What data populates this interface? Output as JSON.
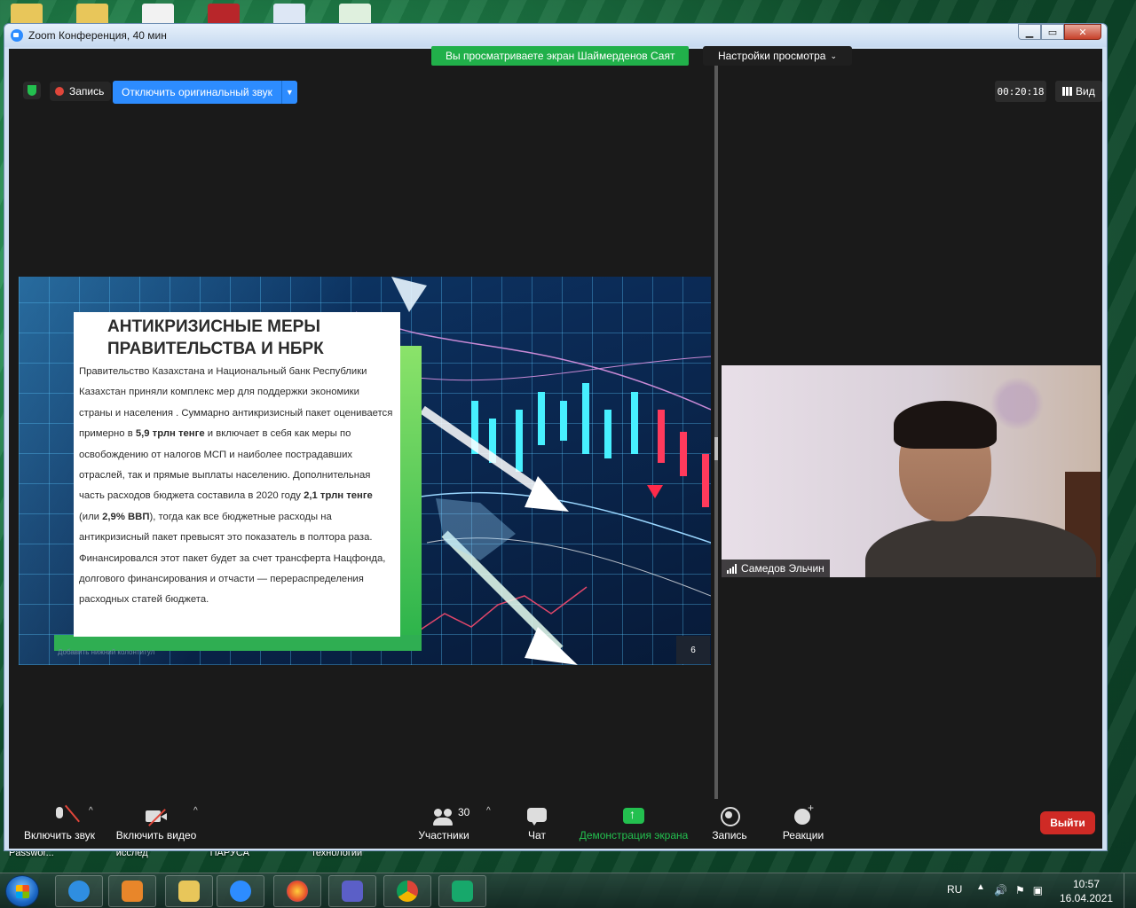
{
  "window": {
    "title": "Zoom Конференция, 40 мин",
    "share_banner": "Вы просматриваете экран Шаймерденов Саят",
    "view_settings": "Настройки просмотра"
  },
  "top_controls": {
    "record_label": "Запись",
    "audio_button": "Отключить оригинальный звук",
    "timer": "00:20:18",
    "view_label": "Вид"
  },
  "slide": {
    "title_line1": "АНТИКРИЗИСНЫЕ МЕРЫ",
    "title_line2": "ПРАВИТЕЛЬСТВА И НБРК",
    "body_part1": "Правительство Казахстана и Национальный банк Республики Казахстан  приняли комплекс мер для поддержки экономики страны и населения . Суммарно антикризисный пакет оценивается примерно в ",
    "bold1": "5,9 трлн тенге",
    "body_part2": " и включает в себя как меры по освобождению от налогов МСП и наиболее пострадавших отраслей, так и прямые выплаты населению. Дополнительная часть расходов бюджета составила в 2020 году ",
    "bold2": "2,1 трлн тенге",
    "body_part3": " (или ",
    "bold3": "2,9% ВВП",
    "body_part4": "), тогда как все бюджетные расходы на антикризисный пакет превысят это показатель в полтора раза. Финансировался этот пакет будет за счет трансферта Нацфонда, долгового финансирования и отчасти — перераспределения расходных статей бюджета.",
    "footer": "Добавить нижний колонтитул",
    "page_number": "6"
  },
  "video": {
    "participant_name": "Самедов Эльчин"
  },
  "toolbar": {
    "unmute": "Включить звук",
    "start_video": "Включить видео",
    "participants": "Участники",
    "participants_count": "30",
    "chat": "Чат",
    "share_screen": "Демонстрация экрана",
    "record": "Запись",
    "reactions": "Реакции",
    "leave": "Выйти"
  },
  "desktop": {
    "labels": [
      "Passwor...",
      "исслед",
      "ПАРУСА",
      "технологии"
    ]
  },
  "taskbar": {
    "language": "RU",
    "time": "10:57",
    "date": "16.04.2021"
  },
  "colors": {
    "zoom_blue": "#2d8cff",
    "share_green": "#21b04a",
    "leave_red": "#cf2a25"
  },
  "icons": [
    "shield-icon",
    "record-dot-icon",
    "grid-icon",
    "mic-muted-icon",
    "camera-off-icon",
    "participants-icon",
    "chat-icon",
    "share-screen-icon",
    "record-icon",
    "reactions-icon",
    "signal-icon"
  ]
}
